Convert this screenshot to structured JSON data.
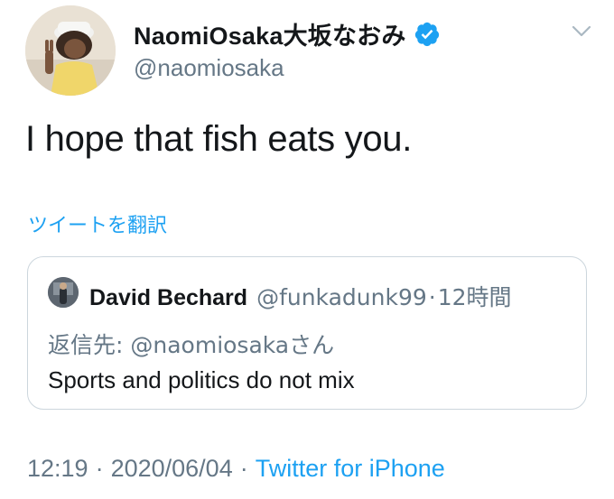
{
  "tweet": {
    "author": {
      "display_name": "NaomiOsaka大坂なおみ",
      "handle": "@naomiosaka",
      "verified": true
    },
    "text": "I hope that fish eats you.",
    "translate_label": "ツイートを翻訳",
    "quoted": {
      "author_name": "David Bechard",
      "author_handle": "@funkadunk99",
      "separator": "·",
      "time_ago": "12時間",
      "reply_to_label": "返信先: ",
      "reply_to_handle": "@naomiosaka",
      "reply_to_suffix": "さん",
      "text": "Sports and politics do not mix"
    },
    "footer": {
      "time": "12:19",
      "sep1": "·",
      "date": "2020/06/04",
      "sep2": "·",
      "source": "Twitter for iPhone"
    }
  },
  "icons": {
    "verified": "verified-badge-icon",
    "menu": "chevron-down-icon"
  },
  "colors": {
    "accent": "#1da1f2",
    "text": "#14171a",
    "secondary": "#657786",
    "border": "#ccd6dd"
  }
}
